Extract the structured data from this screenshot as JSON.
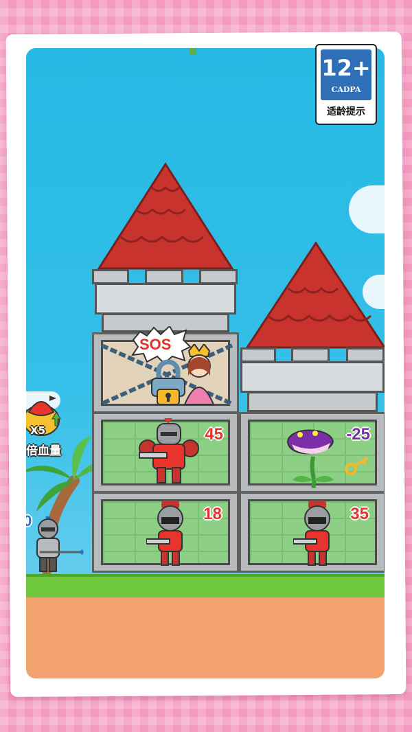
{
  "rating": {
    "age": "12+",
    "org": "CADPA",
    "tip": "适龄提示"
  },
  "sos_text": "SOS",
  "booster": {
    "multiplier": "X5",
    "label": "倍血量"
  },
  "hero": {
    "partial_power": "0"
  },
  "rooms": [
    {
      "id": "left-2",
      "enemy": "red armored knight",
      "power": "45",
      "color": "#e8342c"
    },
    {
      "id": "right-2",
      "enemy": "purple piranha plant",
      "power": "-25",
      "color": "#7b2fa6"
    },
    {
      "id": "left-3",
      "enemy": "red soldier",
      "power": "18",
      "color": "#e8342c"
    },
    {
      "id": "right-3",
      "enemy": "red soldier",
      "power": "35",
      "color": "#e8342c"
    }
  ],
  "icons": [
    "lock-icon",
    "key-icon",
    "chain-icon",
    "crown-icon",
    "video-icon",
    "arrow-up-icon"
  ],
  "colors": {
    "sky": "#35c0e8",
    "roof": "#c8332d",
    "grass": "#6fc83e",
    "dirt": "#f3a36d",
    "frame_bg": "#f49ac0"
  }
}
